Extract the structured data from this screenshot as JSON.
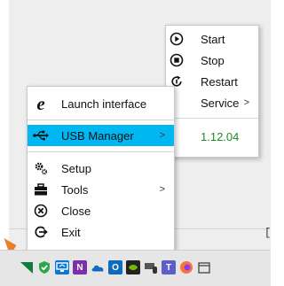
{
  "main_menu": {
    "items": [
      {
        "label": "Launch interface"
      },
      {
        "label": "USB Manager",
        "arrow": ">"
      },
      {
        "label": "Setup"
      },
      {
        "label": "Tools",
        "arrow": ">"
      },
      {
        "label": "Close"
      },
      {
        "label": "Exit"
      }
    ]
  },
  "service_menu": {
    "items": [
      {
        "label": "Start"
      },
      {
        "label": "Stop"
      },
      {
        "label": "Restart"
      },
      {
        "label": "Service",
        "arrow": ">"
      }
    ],
    "version": "1.12.04"
  },
  "background": {
    "bracket": "["
  },
  "colors": {
    "highlight": "#00b7f1",
    "version_text": "#1f8a2a",
    "pointer": "#e8802b"
  },
  "tray_icons": [
    "triangle-green-icon",
    "shield-check-icon",
    "remote-desktop-icon",
    "onenote-icon",
    "onedrive-icon",
    "outlook-icon",
    "nvidia-icon",
    "mouse-keyboard-icon",
    "teams-icon",
    "firefox-icon",
    "partial-tray-icon"
  ]
}
